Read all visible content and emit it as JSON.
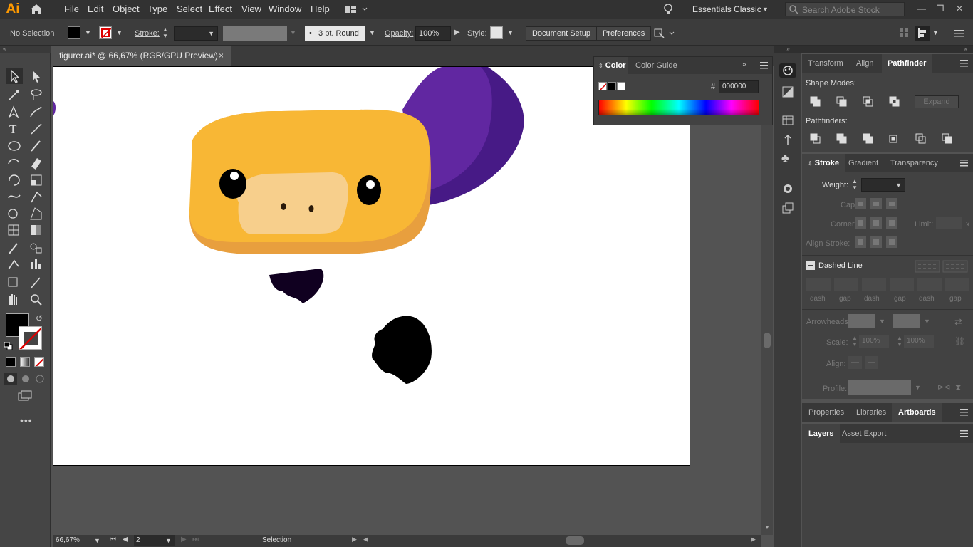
{
  "app": {
    "logo": "Ai"
  },
  "menu": [
    "File",
    "Edit",
    "Object",
    "Type",
    "Select",
    "Effect",
    "View",
    "Window",
    "Help"
  ],
  "workspace": {
    "name": "Essentials Classic",
    "search_placeholder": "Search Adobe Stock"
  },
  "control_bar": {
    "selection": "No Selection",
    "stroke_label": "Stroke:",
    "brush": "3 pt. Round",
    "opacity_label": "Opacity:",
    "opacity_value": "100%",
    "style_label": "Style:",
    "document_setup": "Document Setup",
    "preferences": "Preferences"
  },
  "document": {
    "tab_title": "figurer.ai* @ 66,67% (RGB/GPU Preview)",
    "close": "×"
  },
  "status_bar": {
    "zoom": "66,67%",
    "artboard": "2",
    "tool": "Selection"
  },
  "color_panel": {
    "tabs": [
      "Color",
      "Color Guide"
    ],
    "hash": "#",
    "hex": "000000"
  },
  "transform_panel": {
    "tabs": [
      "Transform",
      "Align",
      "Pathfinder"
    ],
    "shape_modes": "Shape Modes:",
    "expand": "Expand",
    "pathfinders": "Pathfinders:"
  },
  "stroke_panel": {
    "tabs": [
      "Stroke",
      "Gradient",
      "Transparency"
    ],
    "weight": "Weight:",
    "cap": "Cap:",
    "corner": "Corner:",
    "limit": "Limit:",
    "limit_x": "x",
    "align_stroke": "Align Stroke:",
    "dashed_line": "Dashed Line",
    "dash_labels": [
      "dash",
      "gap",
      "dash",
      "gap",
      "dash",
      "gap"
    ],
    "arrowheads": "Arrowheads:",
    "scale": "Scale:",
    "scale_1": "100%",
    "scale_2": "100%",
    "align": "Align:",
    "profile": "Profile:"
  },
  "lower_tabs": [
    "Properties",
    "Libraries",
    "Artboards"
  ],
  "layers_tabs": [
    "Layers",
    "Asset Export"
  ],
  "colors": {
    "accent": "#ff9a00",
    "body": "#f8b735",
    "purple": "#6127a1"
  }
}
